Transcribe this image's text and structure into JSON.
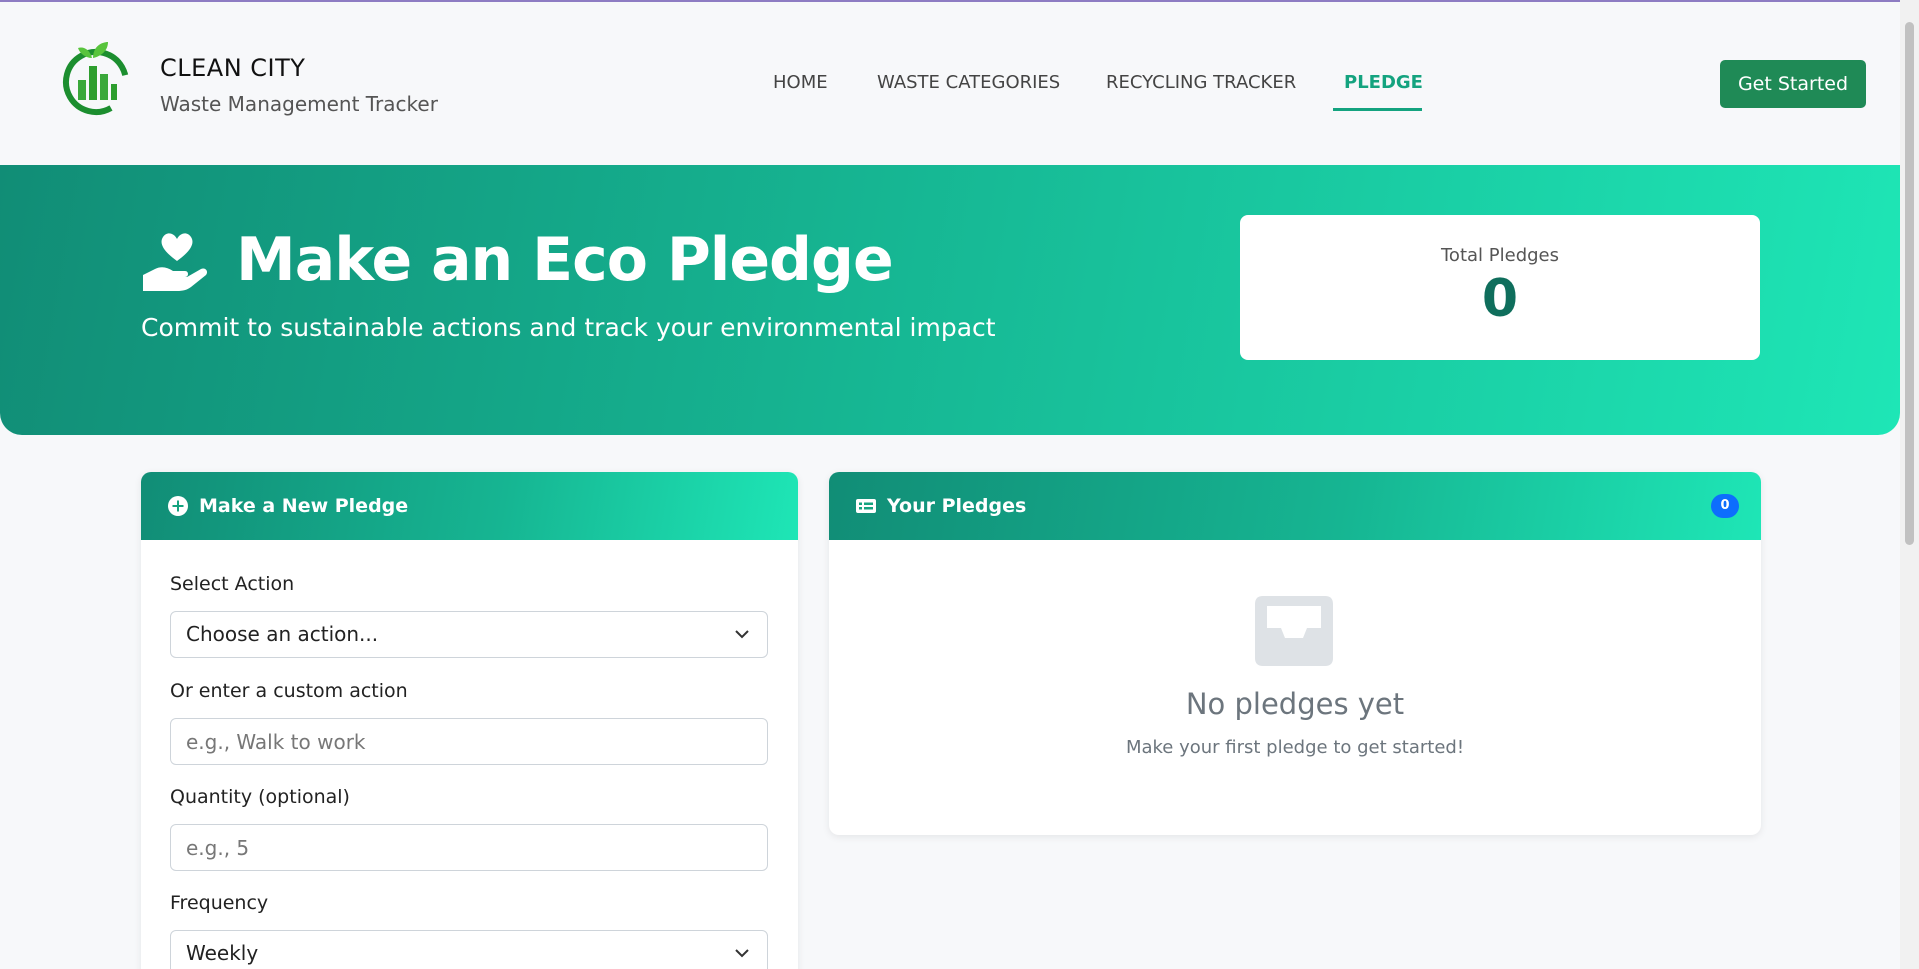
{
  "brand": {
    "title": "CLEAN CITY",
    "subtitle": "Waste Management Tracker",
    "logo_icon": "recycling-city-logo"
  },
  "nav": {
    "items": [
      {
        "label": "HOME",
        "active": false
      },
      {
        "label": "WASTE CATEGORIES",
        "active": false
      },
      {
        "label": "RECYCLING TRACKER",
        "active": false
      },
      {
        "label": "PLEDGE",
        "active": true
      }
    ],
    "cta": "Get Started"
  },
  "hero": {
    "icon": "hand-holding-heart-icon",
    "title": "Make an Eco Pledge",
    "subtitle": "Commit to sustainable actions and track your environmental impact",
    "stat_label": "Total Pledges",
    "stat_value": "0"
  },
  "new_pledge": {
    "title": "Make a New Pledge",
    "icon": "plus-circle-icon",
    "select_action_label": "Select Action",
    "select_action_value": "Choose an action...",
    "custom_action_label": "Or enter a custom action",
    "custom_action_placeholder": "e.g., Walk to work",
    "quantity_label": "Quantity (optional)",
    "quantity_placeholder": "e.g., 5",
    "frequency_label": "Frequency",
    "frequency_value": "Weekly"
  },
  "your_pledges": {
    "title": "Your Pledges",
    "icon": "list-card-icon",
    "count": "0",
    "empty_icon": "inbox-icon",
    "empty_title": "No pledges yet",
    "empty_subtitle": "Make your first pledge to get started!"
  },
  "colors": {
    "primary": "#14a37f",
    "cta": "#1f8a56",
    "gradient_start": "#118d76",
    "gradient_end": "#1ee6b6",
    "badge": "#0d6efd"
  }
}
